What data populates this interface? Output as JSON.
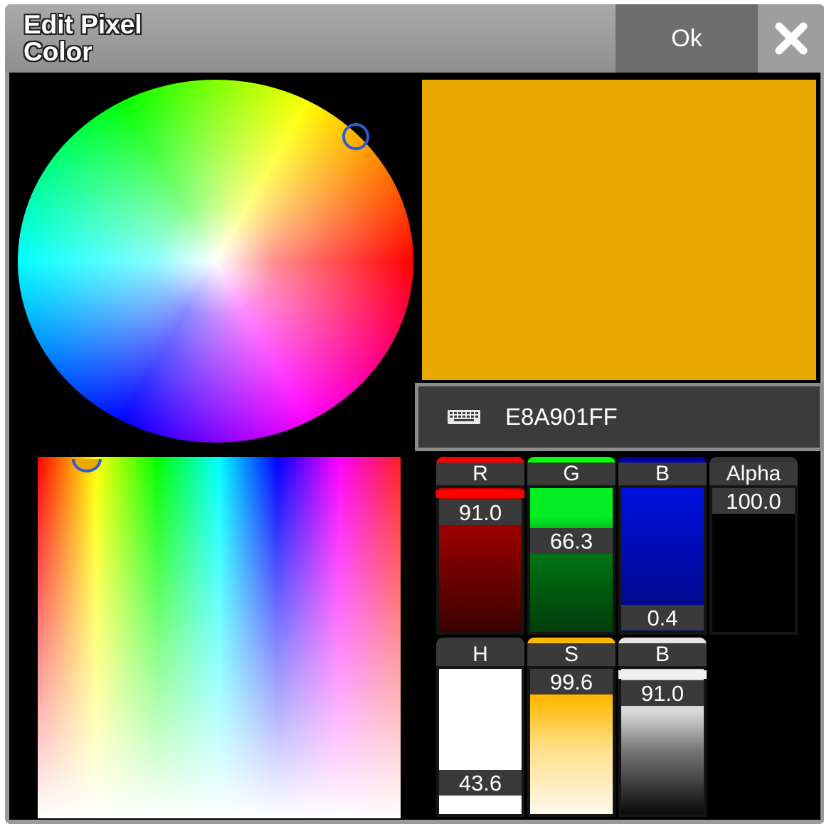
{
  "dialog": {
    "title": "Edit Pixel Color",
    "ok_label": "Ok",
    "close_icon": "close-x-icon"
  },
  "color": {
    "hex_value": "E8A901FF",
    "preview_hex": "#e8a901",
    "keyboard_icon": "keyboard-icon"
  },
  "faders": {
    "rgb": [
      {
        "label": "R",
        "value": "91.0",
        "accent": "#ff0000",
        "level": 0.91
      },
      {
        "label": "G",
        "value": "66.3",
        "accent": "#00ff00",
        "level": 0.663
      },
      {
        "label": "B",
        "value": "0.4",
        "accent": "#0000aa",
        "level": 0.004
      },
      {
        "label": "Alpha",
        "value": "100.0",
        "accent": "#333333",
        "level": 1.0
      }
    ],
    "hsb": [
      {
        "label": "H",
        "value": "43.6",
        "accent": "#3a3a3a",
        "level": 0.121
      },
      {
        "label": "S",
        "value": "99.6",
        "accent": "#ffb800",
        "level": 0.996
      },
      {
        "label": "B",
        "value": "91.0",
        "accent": "#e6e6e6",
        "level": 0.91
      }
    ]
  }
}
